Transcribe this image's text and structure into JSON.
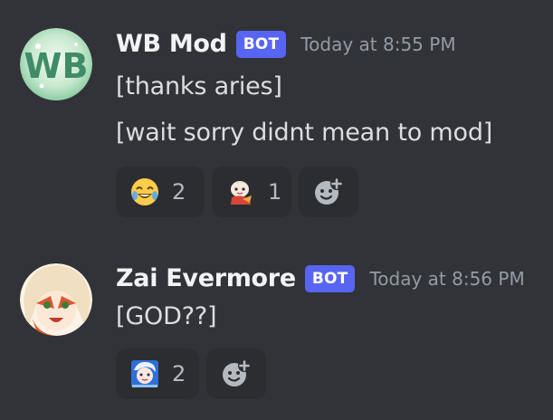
{
  "messages": [
    {
      "author": "WB Mod",
      "bot_tag": "BOT",
      "timestamp": "Today at 8:55 PM",
      "avatar_icon": "wb-logo-avatar",
      "lines": [
        "[thanks aries]",
        "[wait sorry didnt mean to mod]"
      ],
      "reactions": [
        {
          "emoji": "joy-emoji",
          "count": "2"
        },
        {
          "emoji": "custom-chibi-emoji",
          "count": "1"
        }
      ]
    },
    {
      "author": "Zai Evermore",
      "bot_tag": "BOT",
      "timestamp": "Today at 8:56 PM",
      "avatar_icon": "zai-portrait-avatar",
      "lines": [
        "[GOD??]"
      ],
      "reactions": [
        {
          "emoji": "custom-blue-character-emoji",
          "count": "2"
        }
      ]
    }
  ],
  "colors": {
    "background": "#313338",
    "bot_tag": "#5865f2",
    "reaction_bg": "#2b2d31",
    "timestamp": "#949ba4"
  }
}
